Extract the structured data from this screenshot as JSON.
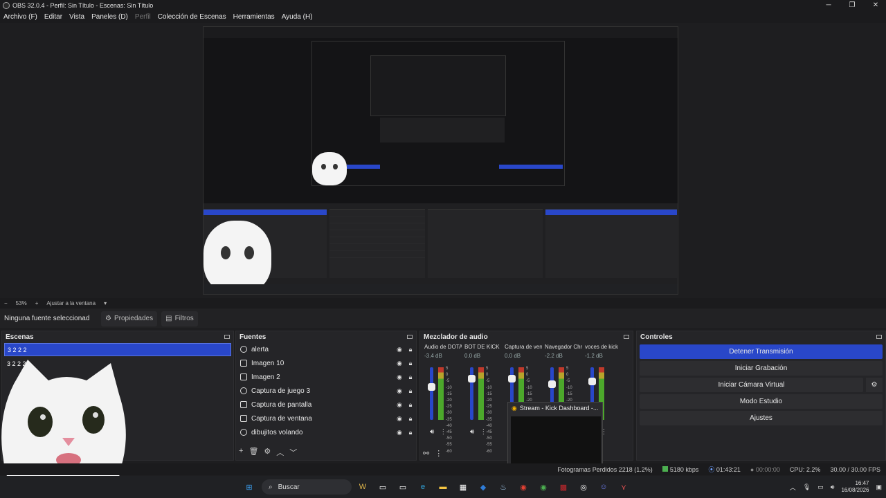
{
  "window": {
    "title": "OBS 32.0.4 - Perfil: Sin Título - Escenas: Sin Título"
  },
  "menu": [
    "Archivo (F)",
    "Editar",
    "Vista",
    "Paneles (D)",
    "Perfil",
    "Colección de Escenas",
    "Herramientas",
    "Ayuda (H)"
  ],
  "zoom": {
    "minus": "−",
    "value": "53%",
    "plus": "+",
    "fit": "Ajustar a la ventana"
  },
  "source_bar": {
    "none_selected": "Ninguna fuente seleccionad",
    "properties": "Propiedades",
    "filters": "Filtros"
  },
  "scenes": {
    "title": "Escenas",
    "items": [
      "3 2 2 2",
      "3 2 2 2"
    ]
  },
  "sources": {
    "title": "Fuentes",
    "items": [
      "alerta",
      "Imagen 10",
      "Imagen 2",
      "Captura de juego 3",
      "Captura de pantalla",
      "Captura de ventana",
      "dibujitos volando"
    ]
  },
  "mixer": {
    "title": "Mezclador de audio",
    "channels": [
      {
        "name": "Audio de DOTA",
        "db": "-3.4 dB",
        "level": 0.7
      },
      {
        "name": "BOT DE KICK",
        "db": "0.0 dB",
        "level": 0.85
      },
      {
        "name": "Captura de ventana",
        "db": "0.0 dB",
        "level": 0.85
      },
      {
        "name": "Navegador Chr",
        "db": "-2.2 dB",
        "level": 0.75
      },
      {
        "name": "voces de kick",
        "db": "-1.2 dB",
        "level": 0.8
      }
    ],
    "scale": [
      "5",
      "0",
      "-5",
      "-10",
      "-15",
      "-20",
      "-25",
      "-30",
      "-35",
      "-40",
      "-45",
      "-50",
      "-55",
      "-60"
    ]
  },
  "controls": {
    "title": "Controles",
    "buttons": [
      "Detener Transmisión",
      "Iniciar Grabación",
      "Iniciar Cámara Virtual",
      "Modo Estudio",
      "Ajustes"
    ]
  },
  "status": {
    "dropped": "Fotogramas Perdidos 2218 (1.2%)",
    "bitrate": "5180 kbps",
    "stream_time": "01:43:21",
    "rec_time": "00:00:00",
    "cpu": "CPU: 2.2%",
    "fps": "30.00 / 30.00 FPS"
  },
  "popup": {
    "title": "Stream - Kick Dashboard -..."
  },
  "taskbar": {
    "search": "Buscar",
    "time": "16:47",
    "date": "16/08/2026"
  },
  "colors": {
    "accent": "#2947c9",
    "bg": "#1e1e20",
    "panel": "#252528"
  },
  "icons": [
    "windows-icon",
    "search-icon",
    "chrome-icon",
    "steam-icon",
    "discord-icon",
    "gear-icon",
    "eye-icon",
    "lock-icon"
  ]
}
